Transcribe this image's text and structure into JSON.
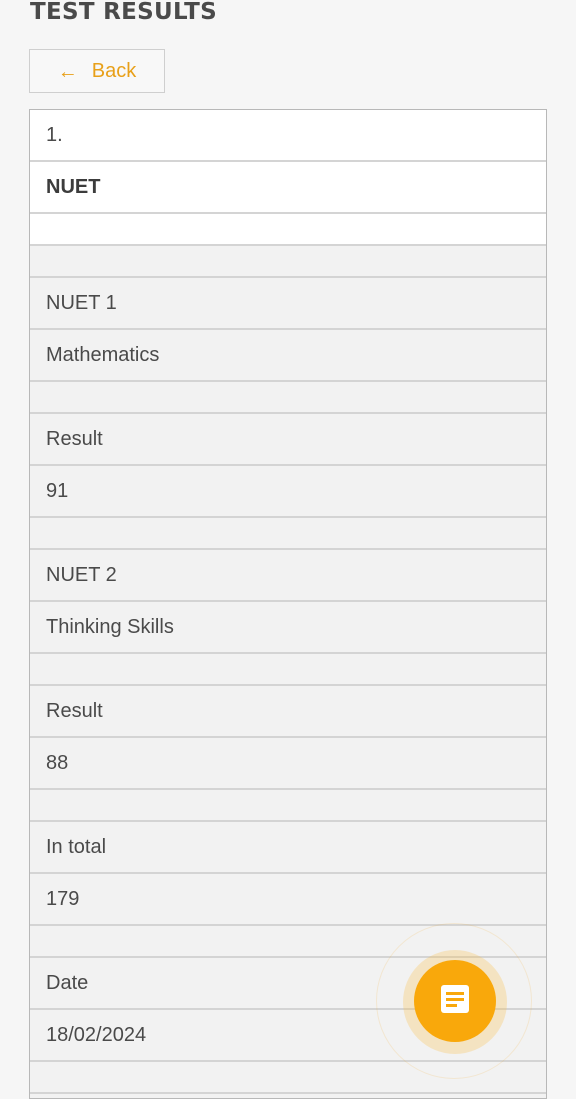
{
  "page": {
    "title": "TEST RESULTS"
  },
  "back_button": {
    "arrow": "←",
    "label": "Back"
  },
  "results": {
    "number": "1.",
    "exam": "NUET",
    "part1": {
      "name": "NUET 1",
      "subject": "Mathematics",
      "result_label": "Result",
      "result_value": "91"
    },
    "part2": {
      "name": "NUET 2",
      "subject": "Thinking Skills",
      "result_label": "Result",
      "result_value": "88"
    },
    "total_label": "In total",
    "total_value": "179",
    "date_label": "Date",
    "date_value": "18/02/2024"
  },
  "fab": {
    "icon": "note-icon"
  },
  "colors": {
    "accent": "#f9a80b",
    "back_text": "#e8a019",
    "text": "#4a4a4a",
    "border": "#d4d4d4"
  }
}
